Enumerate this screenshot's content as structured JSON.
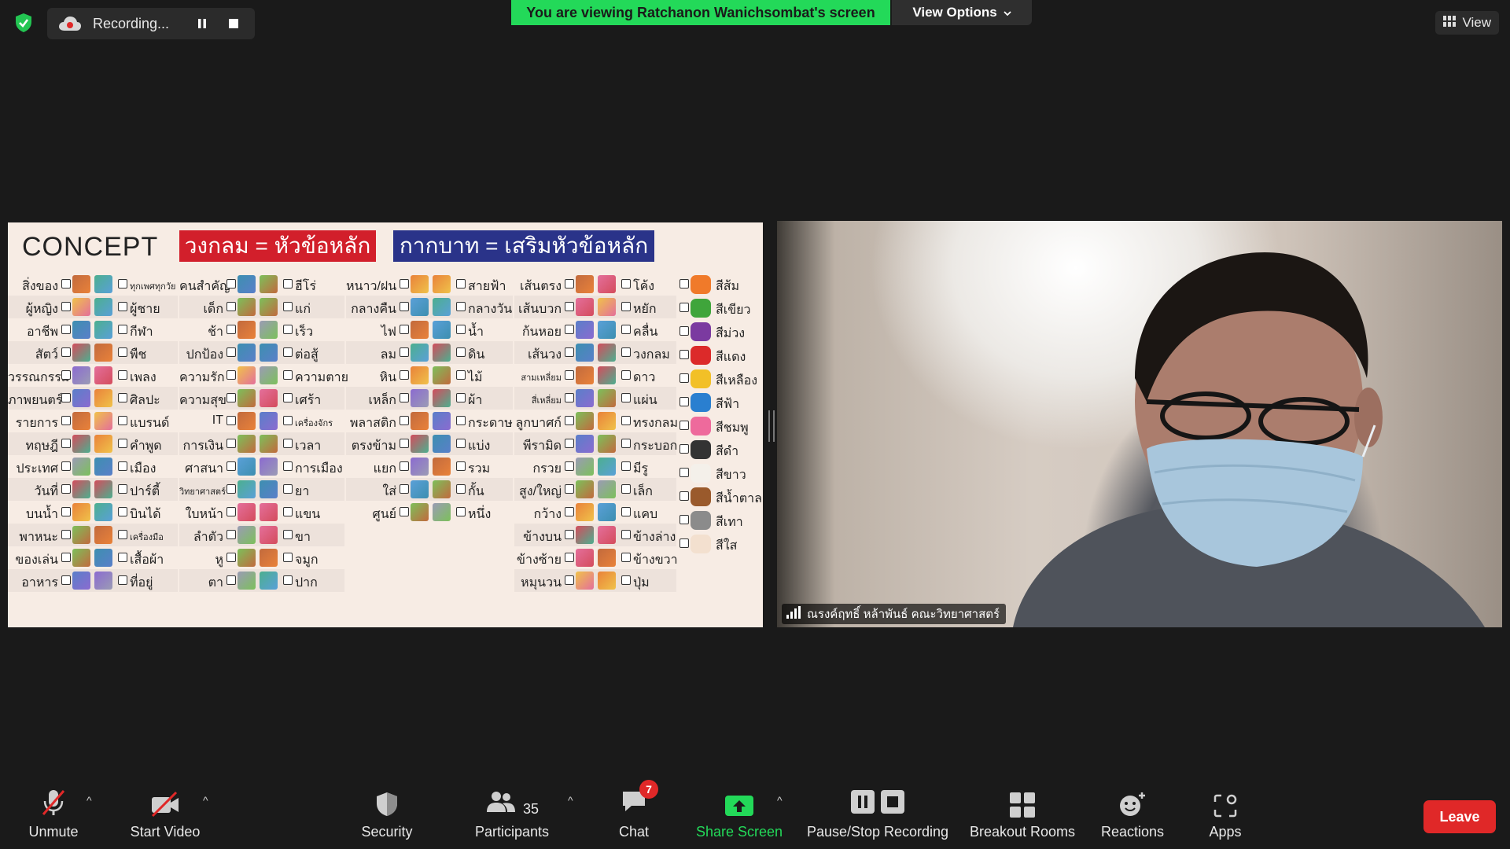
{
  "top": {
    "recording_label": "Recording...",
    "banner": "You are viewing Ratchanon Wanichsombat's screen",
    "view_options": "View Options",
    "view": "View"
  },
  "slide": {
    "title": "CONCEPT",
    "red_label": "วงกลม = หัวข้อหลัก",
    "blue_label": "กากบาท = เสริมหัวข้อหลัก",
    "col1": [
      {
        "left": "สิ่งของ",
        "right": "ทุกเพศทุกวัย"
      },
      {
        "left": "ผู้หญิง",
        "right": "ผู้ชาย"
      },
      {
        "left": "อาชีพ",
        "right": "กีฬา"
      },
      {
        "left": "สัตว์",
        "right": "พืช"
      },
      {
        "left": "วรรณกรรม",
        "right": "เพลง"
      },
      {
        "left": "ภาพยนตร์",
        "right": "ศิลปะ"
      },
      {
        "left": "รายการ",
        "right": "แบรนด์"
      },
      {
        "left": "ทฤษฎี",
        "right": "คำพูด"
      },
      {
        "left": "ประเทศ",
        "right": "เมือง"
      },
      {
        "left": "วันที่",
        "right": "ปาร์ตี้"
      },
      {
        "left": "บนน้ำ",
        "right": "บินได้"
      },
      {
        "left": "พาหนะ",
        "right": "เครื่องมือ"
      },
      {
        "left": "ของเล่น",
        "right": "เสื้อผ้า"
      },
      {
        "left": "อาหาร",
        "right": "ที่อยู่"
      }
    ],
    "col2": [
      {
        "left": "คนสำคัญ",
        "right": "ฮีโร่"
      },
      {
        "left": "เด็ก",
        "right": "แก่"
      },
      {
        "left": "ช้า",
        "right": "เร็ว"
      },
      {
        "left": "ปกป้อง",
        "right": "ต่อสู้"
      },
      {
        "left": "ความรัก",
        "right": "ความตาย"
      },
      {
        "left": "ความสุข",
        "right": "เศร้า"
      },
      {
        "left": "IT",
        "right": "เครื่องจักร"
      },
      {
        "left": "การเงิน",
        "right": "เวลา"
      },
      {
        "left": "ศาสนา",
        "right": "การเมือง"
      },
      {
        "left": "วิทยาศาสตร์",
        "right": "ยา"
      },
      {
        "left": "ใบหน้า",
        "right": "แขน"
      },
      {
        "left": "ลำตัว",
        "right": "ขา"
      },
      {
        "left": "หู",
        "right": "จมูก"
      },
      {
        "left": "ตา",
        "right": "ปาก"
      }
    ],
    "col3": [
      {
        "left": "หนาว/ฝน",
        "right": "สายฟ้า"
      },
      {
        "left": "กลางคืน",
        "right": "กลางวัน"
      },
      {
        "left": "ไฟ",
        "right": "น้ำ"
      },
      {
        "left": "ลม",
        "right": "ดิน"
      },
      {
        "left": "หิน",
        "right": "ไม้"
      },
      {
        "left": "เหล็ก",
        "right": "ผ้า"
      },
      {
        "left": "พลาสติก",
        "right": "กระดาษ"
      },
      {
        "left": "ตรงข้าม",
        "right": "แบ่ง"
      },
      {
        "left": "แยก",
        "right": "รวม"
      },
      {
        "left": "ใส่",
        "right": "กั้น"
      },
      {
        "left": "ศูนย์",
        "right": "หนึ่ง"
      }
    ],
    "col4": [
      {
        "left": "เส้นตรง",
        "right": "โค้ง"
      },
      {
        "left": "เส้นบวก",
        "right": "หยัก"
      },
      {
        "left": "ก้นหอย",
        "right": "คลื่น"
      },
      {
        "left": "เส้นวง",
        "right": "วงกลม"
      },
      {
        "left": "สามเหลี่ยม",
        "right": "ดาว"
      },
      {
        "left": "สี่เหลี่ยม",
        "right": "แผ่น"
      },
      {
        "left": "ลูกบาศก์",
        "right": "ทรงกลม"
      },
      {
        "left": "พีรามิด",
        "right": "กระบอก"
      },
      {
        "left": "กรวย",
        "right": "มีรู"
      },
      {
        "left": "สูง/ใหญ่",
        "right": "เล็ก"
      },
      {
        "left": "กว้าง",
        "right": "แคบ"
      },
      {
        "left": "ข้างบน",
        "right": "ข้างล่าง"
      },
      {
        "left": "ข้างซ้าย",
        "right": "ข้างขวา"
      },
      {
        "left": "หมุนวน",
        "right": "ปุ่ม"
      }
    ],
    "colors": [
      {
        "label": "สีส้ม",
        "hex": "#f07a2a"
      },
      {
        "label": "สีเขียว",
        "hex": "#3fa53b"
      },
      {
        "label": "สีม่วง",
        "hex": "#7b3aa0"
      },
      {
        "label": "สีแดง",
        "hex": "#dc2a2a"
      },
      {
        "label": "สีเหลือง",
        "hex": "#f2c027"
      },
      {
        "label": "สีฟ้า",
        "hex": "#2a7fd0"
      },
      {
        "label": "สีชมพู",
        "hex": "#ee6a9c"
      },
      {
        "label": "สีดำ",
        "hex": "#333333"
      },
      {
        "label": "สีขาว",
        "hex": "#f4f0ea"
      },
      {
        "label": "สีน้ำตาล",
        "hex": "#9a5a2c"
      },
      {
        "label": "สีเทา",
        "hex": "#8b8b8b"
      },
      {
        "label": "สีใส",
        "hex": "#f3e0cf"
      }
    ]
  },
  "camera": {
    "name": "ณรงค์ฤทธิ์ หล้าพันธ์ คณะวิทยาศาสตร์"
  },
  "toolbar": {
    "unmute": "Unmute",
    "start_video": "Start Video",
    "security": "Security",
    "participants": "Participants",
    "participant_count": "35",
    "chat": "Chat",
    "chat_badge": "7",
    "share_screen": "Share Screen",
    "pause_stop": "Pause/Stop Recording",
    "breakout": "Breakout Rooms",
    "reactions": "Reactions",
    "apps": "Apps",
    "leave": "Leave"
  }
}
